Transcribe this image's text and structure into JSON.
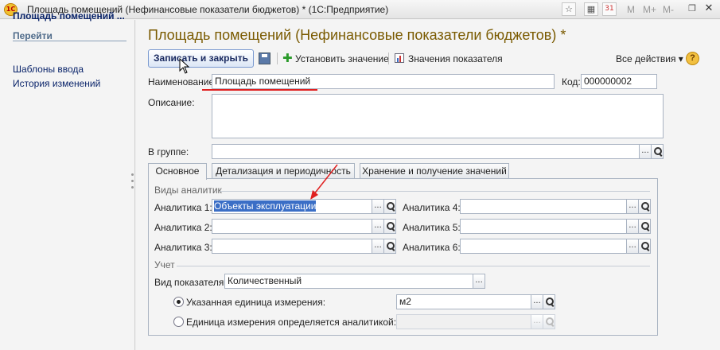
{
  "window": {
    "title": "Площадь помещений (Нефинансовые показатели бюджетов) * (1С:Предприятие)",
    "app_icon_text": "1С",
    "toolbar_letters": [
      "M",
      "M+",
      "M-"
    ]
  },
  "sidebar": {
    "title": "Площадь помещений ...",
    "nav_header": "Перейти",
    "items": [
      {
        "label": "Шаблоны ввода"
      },
      {
        "label": "История изменений"
      }
    ]
  },
  "page": {
    "title": "Площадь помещений (Нефинансовые показатели бюджетов) *"
  },
  "toolbar": {
    "save_close_label": "Записать и закрыть",
    "set_value_label": "Установить значение",
    "values_label": "Значения показателя",
    "all_actions_label": "Все действия ▾",
    "help_label": "?"
  },
  "form": {
    "name_label": "Наименование:",
    "name_value": "Площадь помещений",
    "code_label": "Код:",
    "code_value": "000000002",
    "description_label": "Описание:",
    "description_value": "",
    "group_label": "В группе:",
    "group_value": ""
  },
  "tabs": [
    {
      "label": "Основное",
      "active": true
    },
    {
      "label": "Детализация и периодичность",
      "active": false
    },
    {
      "label": "Хранение и получение значений",
      "active": false
    }
  ],
  "analytics": {
    "group_title": "Виды аналитик",
    "items": [
      {
        "label": "Аналитика 1:",
        "value": "Объекты эксплуатации"
      },
      {
        "label": "Аналитика 2:",
        "value": ""
      },
      {
        "label": "Аналитика 3:",
        "value": ""
      },
      {
        "label": "Аналитика 4:",
        "value": ""
      },
      {
        "label": "Аналитика 5:",
        "value": ""
      },
      {
        "label": "Аналитика 6:",
        "value": ""
      }
    ]
  },
  "accounting": {
    "group_title": "Учет",
    "indicator_type_label": "Вид показателя:",
    "indicator_type_value": "Количественный",
    "unit_option_label": "Указанная единица измерения:",
    "unit_value": "м2",
    "unit_selected": true,
    "analytic_unit_option_label": "Единица измерения определяется аналитикой:",
    "analytic_unit_value": "",
    "analytic_unit_selected": false
  },
  "colors": {
    "title_color": "#7a5a00",
    "link_color": "#0a246a",
    "annotation_red": "#e02020",
    "selection_blue": "#3a6ec6"
  },
  "icons": {
    "button_ellipsis": "...",
    "clear_glyph": "✕"
  }
}
